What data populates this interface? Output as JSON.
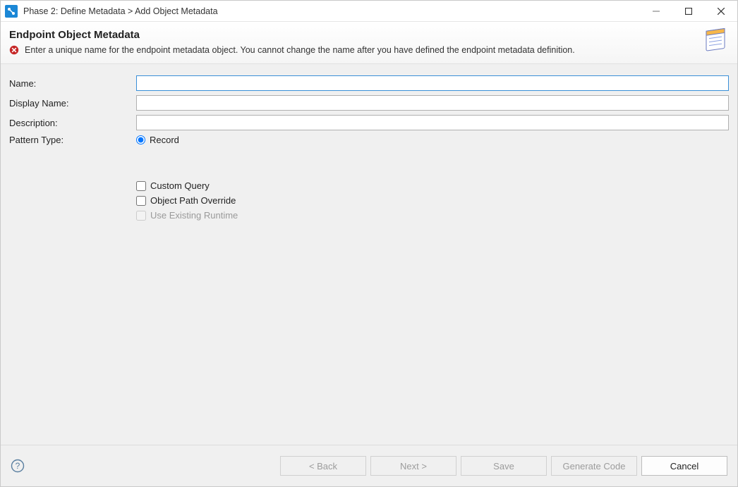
{
  "titlebar": {
    "title": "Phase 2: Define Metadata > Add Object Metadata"
  },
  "header": {
    "heading": "Endpoint Object Metadata",
    "message": "Enter a unique name for the endpoint metadata object. You cannot change the name after you have defined the endpoint metadata definition."
  },
  "form": {
    "name_label": "Name:",
    "name_value": "",
    "display_name_label": "Display Name:",
    "display_name_value": "",
    "description_label": "Description:",
    "description_value": "",
    "pattern_type_label": "Pattern Type:",
    "pattern_type_option": "Record",
    "custom_query_label": "Custom Query",
    "object_path_override_label": "Object Path Override",
    "use_existing_runtime_label": "Use Existing Runtime"
  },
  "footer": {
    "back": "< Back",
    "next": "Next >",
    "save": "Save",
    "generate_code": "Generate Code",
    "cancel": "Cancel"
  }
}
